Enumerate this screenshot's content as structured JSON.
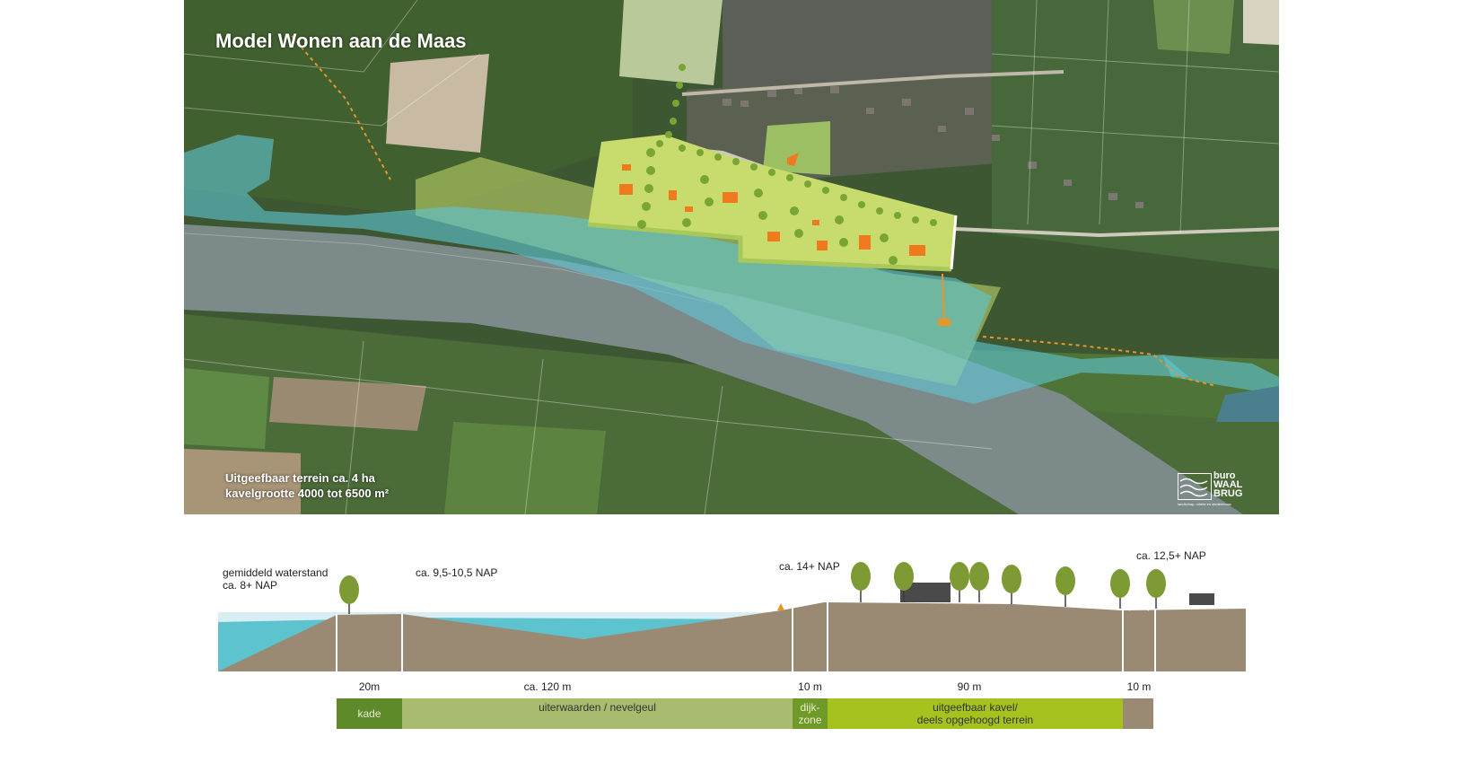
{
  "map": {
    "title": "Model Wonen aan de Maas",
    "note_line1": "Uitgeefbaar terrein ca. 4 ha",
    "note_line2": "kavelgrootte 4000 tot 6500 m²",
    "logo": {
      "line1": "buro",
      "line2": "WAAL",
      "line3": "BRUG",
      "tagline": "landschap, ruimte en stedenbouw"
    },
    "colors": {
      "river": "#7d8a8a",
      "floodplain_water": "#5fc6d6",
      "development_zone": "#c8dc6e",
      "dike_zone": "#a8c85a",
      "building": "#f07a1e",
      "boundary_line": "#e8962a"
    }
  },
  "section": {
    "labels": {
      "water_level_line1": "gemiddeld waterstand",
      "water_level_line2": "ca. 8+ NAP",
      "floodplain_height": "ca. 9,5-10,5 NAP",
      "dike_height": "ca. 14+ NAP",
      "plot_height": "ca. 12,5+ NAP"
    },
    "dimensions": {
      "kade": "20m",
      "floodplain": "ca. 120 m",
      "dike": "10 m",
      "plot": "90 m",
      "road": "10 m"
    },
    "zones": {
      "kade": "kade",
      "floodplain": "uiterwaarden / nevelgeul",
      "dike_line1": "dijk-",
      "dike_line2": "zone",
      "plot_line1": "uitgeefbaar kavel/",
      "plot_line2": "deels opgehoogd terrein"
    },
    "colors": {
      "ground": "#9b8a73",
      "water": "#5dc3cf",
      "water_level": "#d8eef2",
      "tree": "#7d9a35",
      "building": "#4a4a4a",
      "kade_zone": "#5e8a2a",
      "floodplain_zone": "#a9bb6e",
      "dike_zone": "#6f9a2a",
      "plot_zone": "#a6c21e",
      "road_zone": "#9b8a73"
    }
  }
}
